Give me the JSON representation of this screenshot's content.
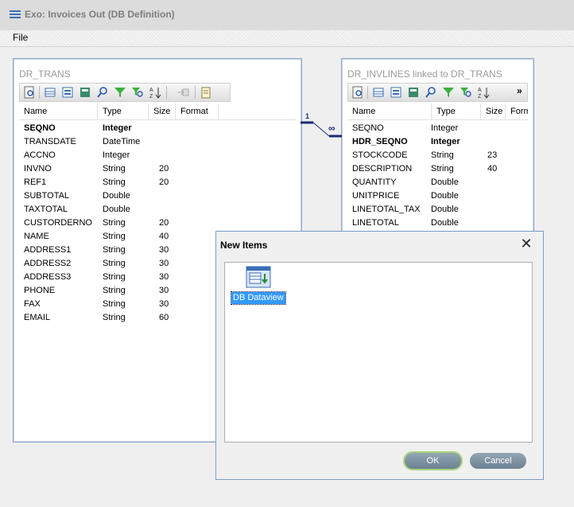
{
  "window": {
    "title": "Exo: Invoices Out (DB Definition)"
  },
  "menu": {
    "file": "File"
  },
  "left_panel": {
    "title": "DR_TRANS",
    "headers": {
      "name": "Name",
      "type": "Type",
      "size": "Size",
      "format": "Format"
    },
    "rows": [
      {
        "name": "SEQNO",
        "type": "Integer",
        "size": "",
        "bold": true
      },
      {
        "name": "TRANSDATE",
        "type": "DateTime",
        "size": ""
      },
      {
        "name": "ACCNO",
        "type": "Integer",
        "size": ""
      },
      {
        "name": "INVNO",
        "type": "String",
        "size": "20"
      },
      {
        "name": "REF1",
        "type": "String",
        "size": "20"
      },
      {
        "name": "SUBTOTAL",
        "type": "Double",
        "size": ""
      },
      {
        "name": "TAXTOTAL",
        "type": "Double",
        "size": ""
      },
      {
        "name": "CUSTORDERNO",
        "type": "String",
        "size": "20"
      },
      {
        "name": "NAME",
        "type": "String",
        "size": "40"
      },
      {
        "name": "ADDRESS1",
        "type": "String",
        "size": "30"
      },
      {
        "name": "ADDRESS2",
        "type": "String",
        "size": "30"
      },
      {
        "name": "ADDRESS3",
        "type": "String",
        "size": "30"
      },
      {
        "name": "PHONE",
        "type": "String",
        "size": "30"
      },
      {
        "name": "FAX",
        "type": "String",
        "size": "30"
      },
      {
        "name": "EMAIL",
        "type": "String",
        "size": "60"
      }
    ]
  },
  "right_panel": {
    "title": "DR_INVLINES linked to DR_TRANS",
    "overflow": "»",
    "headers": {
      "name": "Name",
      "type": "Type",
      "size": "Size",
      "format": "Forma"
    },
    "rows": [
      {
        "name": "SEQNO",
        "type": "Integer",
        "size": ""
      },
      {
        "name": "HDR_SEQNO",
        "type": "Integer",
        "size": "",
        "bold": true
      },
      {
        "name": "STOCKCODE",
        "type": "String",
        "size": "23"
      },
      {
        "name": "DESCRIPTION",
        "type": "String",
        "size": "40"
      },
      {
        "name": "QUANTITY",
        "type": "Double",
        "size": ""
      },
      {
        "name": "UNITPRICE",
        "type": "Double",
        "size": ""
      },
      {
        "name": "LINETOTAL_TAX",
        "type": "Double",
        "size": ""
      },
      {
        "name": "LINETOTAL",
        "type": "Double",
        "size": ""
      }
    ]
  },
  "relation": {
    "one": "1",
    "many": "∞"
  },
  "dialog": {
    "title": "New Items",
    "close": "✕",
    "item_label": "DB Dataview",
    "ok": "OK",
    "cancel": "Cancel"
  }
}
